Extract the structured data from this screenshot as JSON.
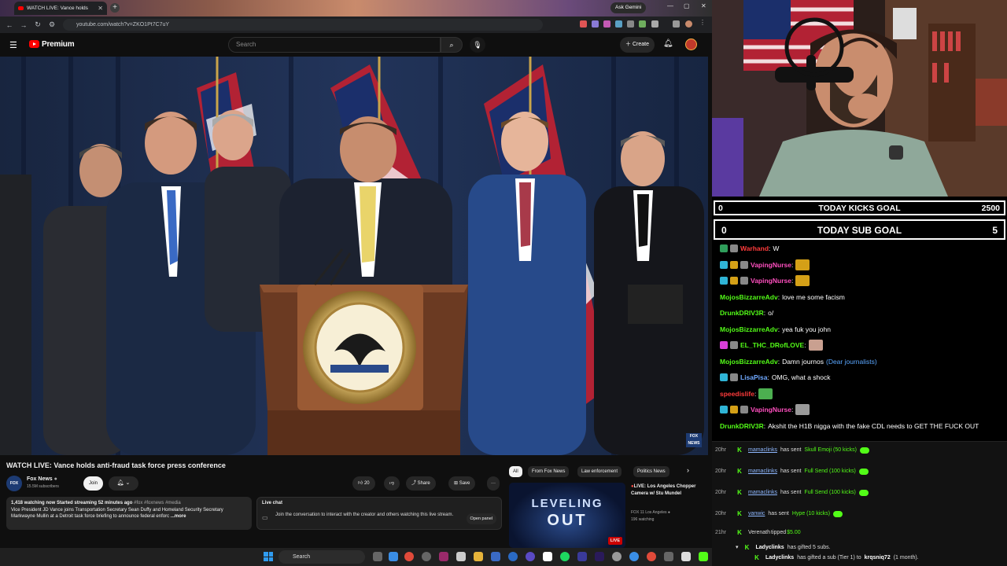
{
  "browser": {
    "tab_title": "WATCH LIVE: Vance holds",
    "ask_gemini": "Ask Gemini",
    "url": "youtube.com/watch?v=ZKO1Pt7C7uY"
  },
  "youtube": {
    "brand": "Premium",
    "search_placeholder": "Search",
    "create_label": "Create",
    "video_title": "WATCH LIVE: Vance holds anti-fraud task force press conference",
    "channel_name": "Fox News",
    "channel_subs": "15.5M subscribers",
    "join_label": "Join",
    "like_count": "20",
    "share_label": "Share",
    "save_label": "Save",
    "fox_bug": "FOX NEWS",
    "description": {
      "meta": "1,418 watching now  Started streaming 52 minutes ago",
      "tags": "#fox #foxnews #media",
      "text": "Vice President JD Vance joins Transportation Secretary Sean Duffy and Homeland Security Secretary Markwayne Mullin at a Detroit task force briefing to announce federal enforc",
      "more": "...more"
    },
    "live_chat": {
      "title": "Live chat",
      "text": "Join the conversation to interact with the creator and others watching this live stream.",
      "button": "Open panel"
    },
    "chips": [
      "All",
      "From Fox News",
      "Law enforcement",
      "Politics News"
    ],
    "recommendation": {
      "thumb_line1": "LEVELING",
      "thumb_line2": "OUT",
      "badge": "LIVE",
      "title": "LIVE: Los Angeles Chopper Camera w/ Stu Mundel",
      "channel": "FOX 11 Los Angeles",
      "watching": "196 watching"
    }
  },
  "taskbar": {
    "search_label": "Search"
  },
  "stream": {
    "goals": [
      {
        "left": "0",
        "label": "TODAY KICKS GOAL",
        "right": "2500"
      },
      {
        "left": "0",
        "label": "TODAY SUB GOAL",
        "right": "5"
      }
    ],
    "chat": [
      {
        "user": "Warhand",
        "color": "#ff3b3b",
        "text": "W",
        "badges": [
          "#2f9e5b",
          "#888"
        ]
      },
      {
        "user": "VapingNurse",
        "color": "#ff4fbf",
        "text": "",
        "emote": "#d4a017",
        "badges": [
          "#2fb4d6",
          "#d4a017",
          "#888"
        ]
      },
      {
        "user": "VapingNurse",
        "color": "#ff4fbf",
        "text": "",
        "emote": "#d4a017",
        "badges": [
          "#2fb4d6",
          "#d4a017",
          "#888"
        ]
      },
      {
        "user": "MojosBizzarreAdv",
        "color": "#53fc18",
        "text": "love me some facism",
        "badges": []
      },
      {
        "user": "DrunkDRIV3R",
        "color": "#53fc18",
        "text": "o/",
        "badges": []
      },
      {
        "user": "MojosBizzarreAdv",
        "color": "#53fc18",
        "text": "yea fuk you john",
        "badges": []
      },
      {
        "user": "EL_THC_DRofLOVE",
        "color": "#53fc18",
        "text": "",
        "emote": "#c9a090",
        "badges": [
          "#d93fd9",
          "#888"
        ]
      },
      {
        "user": "MojosBizzarreAdv",
        "color": "#53fc18",
        "text": "Damn journos",
        "link": "(Dear journalists)",
        "badges": []
      },
      {
        "user": "LisaPisa",
        "color": "#6fa8ff",
        "text": "OMG, what a shock",
        "badges": [
          "#2fb4d6",
          "#888"
        ]
      },
      {
        "user": "speedislife",
        "color": "#ff3b3b",
        "text": "",
        "emote": "#4caf50",
        "badges": []
      },
      {
        "user": "VapingNurse",
        "color": "#ff4fbf",
        "text": "",
        "emote": "#999999",
        "badges": [
          "#2fb4d6",
          "#d4a017",
          "#888"
        ]
      },
      {
        "user": "DrunkDRIV3R",
        "color": "#53fc18",
        "text": "Akshit the H1B nigga with the fake CDL needs to GET THE FUCK OUT",
        "badges": []
      }
    ],
    "alerts": [
      {
        "time": "20hr",
        "user": "mamaclinks",
        "action": "has sent",
        "gift": "Skull Emoji (50 kicks)"
      },
      {
        "time": "20hr",
        "user": "mamaclinks",
        "action": "has sent",
        "gift": "Full Send (100 kicks)"
      },
      {
        "time": "20hr",
        "user": "mamaclinks",
        "action": "has sent",
        "gift": "Full Send (100 kicks)"
      },
      {
        "time": "20hr",
        "user": "vanwic",
        "action": "has sent",
        "gift": "Hype (10 kicks)"
      }
    ],
    "tip": {
      "time": "21hr",
      "user": "Verenath",
      "action": "tipped",
      "amount": "$5.00"
    },
    "subgift": {
      "user": "Ladyclinks",
      "action": "has gifted 5 subs."
    },
    "subgift2": {
      "user": "Ladyclinks",
      "action": "has gifted a sub (Tier 1) to",
      "target": "krqsniq72",
      "suffix": "(1 month)."
    }
  }
}
